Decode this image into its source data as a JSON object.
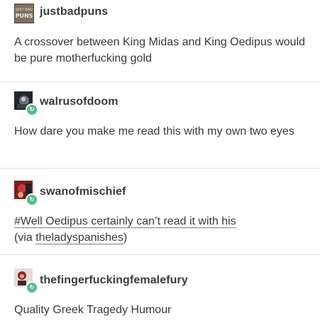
{
  "posts": [
    {
      "username": "justbadpuns",
      "avatar_text": "JUST BAD PUNS",
      "body": "A crossover between King Midas and King Oedipus would be pure motherfucking gold"
    },
    {
      "username": "walrusofdoom",
      "body": "How dare you make me read this with my own two eyes"
    },
    {
      "username": "swanofmischief",
      "tag": "#Well Oedipus certainly can’t read it with his",
      "via_prefix": "(via ",
      "via_link": "theladyspanishes",
      "via_suffix": ")"
    },
    {
      "username": "thefingerfuckingfemalefury",
      "body": "Quality Greek Tragedy Humour"
    }
  ],
  "icons": {
    "reblog": "reblog-icon"
  },
  "colors": {
    "reblog_badge": "#56bc8a",
    "text": "#383838"
  }
}
